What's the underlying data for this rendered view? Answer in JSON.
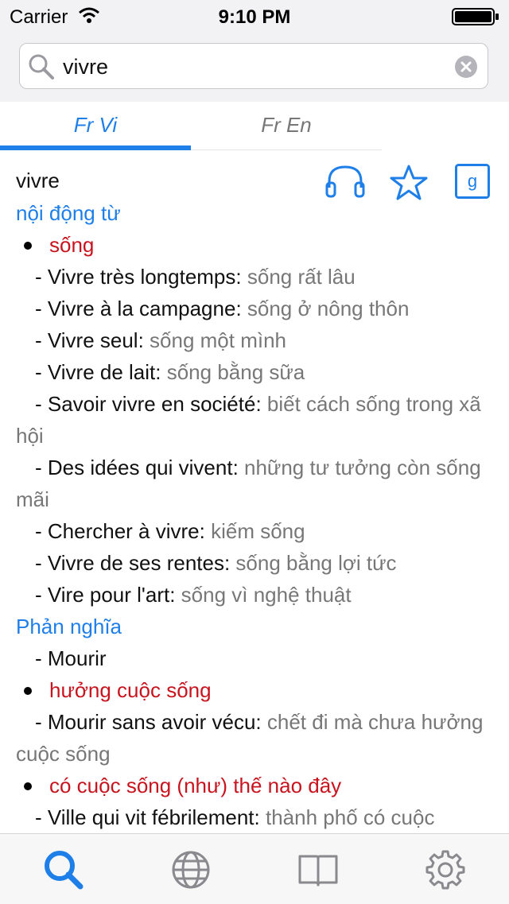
{
  "status_bar": {
    "carrier": "Carrier",
    "time": "9:10 PM"
  },
  "search": {
    "value": "vivre",
    "placeholder": ""
  },
  "tabs": [
    {
      "label": "Fr Vi",
      "active": true
    },
    {
      "label": "Fr En",
      "active": false
    }
  ],
  "entry": {
    "headword": "vivre",
    "actions": [
      "headphones-icon",
      "star-icon",
      "google-icon"
    ],
    "lines": [
      {
        "kind": "pos",
        "text": "nội động từ"
      },
      {
        "kind": "sense",
        "text": "sống"
      },
      {
        "kind": "ex",
        "fr": "- Vivre très longtemps",
        "vi": "sống rất lâu"
      },
      {
        "kind": "ex",
        "fr": "- Vivre à la campagne",
        "vi": "sống ở nông thôn"
      },
      {
        "kind": "ex",
        "fr": "- Vivre seul",
        "vi": "sống một mình"
      },
      {
        "kind": "ex",
        "fr": "- Vivre de lait",
        "vi": "sống bằng sữa"
      },
      {
        "kind": "ex",
        "fr": "- Savoir vivre en société",
        "vi": "biết cách sống trong xã hội"
      },
      {
        "kind": "ex",
        "fr": "- Des idées qui vivent",
        "vi": "những tư tưởng còn sống mãi"
      },
      {
        "kind": "ex",
        "fr": "- Chercher à vivre",
        "vi": "kiếm sống"
      },
      {
        "kind": "ex",
        "fr": "- Vivre de ses rentes",
        "vi": "sống bằng lợi tức"
      },
      {
        "kind": "ex",
        "fr": "- Vire pour l'art",
        "vi": "sống vì nghệ thuật"
      },
      {
        "kind": "pos",
        "text": "Phản nghĩa"
      },
      {
        "kind": "ex",
        "fr": "- Mourir",
        "vi": ""
      },
      {
        "kind": "sense",
        "text": "hưởng cuộc sống"
      },
      {
        "kind": "ex",
        "fr": "- Mourir sans avoir vécu",
        "vi": "chết đi mà chưa hưởng cuộc sống"
      },
      {
        "kind": "sense",
        "text": "có cuộc sống (như) thế nào đây"
      },
      {
        "kind": "ex",
        "fr": "- Ville qui vit fébrilement",
        "vi": "thành phố có cuộc"
      }
    ]
  },
  "tab_bar": [
    {
      "icon": "search-icon",
      "active": true
    },
    {
      "icon": "globe-icon",
      "active": false
    },
    {
      "icon": "book-icon",
      "active": false
    },
    {
      "icon": "gear-icon",
      "active": false
    }
  ],
  "colors": {
    "accent": "#1f7fe8",
    "sense": "#c8141e",
    "translation": "#777777"
  }
}
